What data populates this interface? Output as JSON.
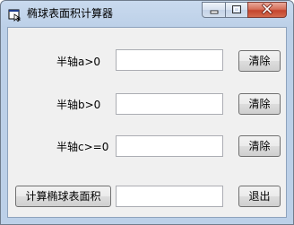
{
  "window": {
    "title": "椭球表面积计算器"
  },
  "fields": [
    {
      "label": "半轴a>0",
      "value": "",
      "clear_label": "清除"
    },
    {
      "label": "半轴b>0",
      "value": "",
      "clear_label": "清除"
    },
    {
      "label": "半轴c>=0",
      "value": "",
      "clear_label": "清除"
    }
  ],
  "result": {
    "compute_label": "计算椭球表面积",
    "value": "",
    "exit_label": "退出"
  },
  "icons": {
    "app": "app-window-icon",
    "minimize": "minimize-icon",
    "maximize": "maximize-icon",
    "close": "close-icon"
  }
}
